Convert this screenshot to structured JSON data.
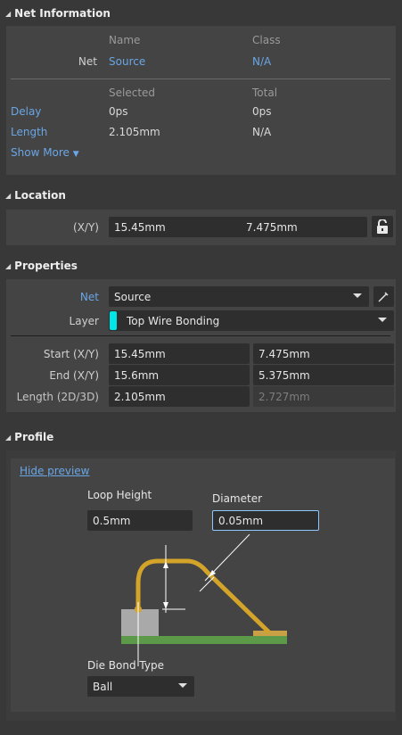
{
  "net_information": {
    "title": "Net Information",
    "col_name": "Name",
    "col_class": "Class",
    "net_label": "Net",
    "net_name": "Source",
    "net_class": "N/A",
    "col_selected": "Selected",
    "col_total": "Total",
    "delay_label": "Delay",
    "delay_selected": "0ps",
    "delay_total": "0ps",
    "length_label": "Length",
    "length_selected": "2.105mm",
    "length_total": "N/A",
    "show_more": "Show More"
  },
  "location": {
    "title": "Location",
    "xy_label": "(X/Y)",
    "x": "15.45mm",
    "y": "7.475mm"
  },
  "properties": {
    "title": "Properties",
    "net_label": "Net",
    "net_value": "Source",
    "layer_label": "Layer",
    "layer_value": "Top Wire Bonding",
    "layer_color": "#00e5e5",
    "start_label": "Start (X/Y)",
    "start_x": "15.45mm",
    "start_y": "7.475mm",
    "end_label": "End (X/Y)",
    "end_x": "15.6mm",
    "end_y": "5.375mm",
    "length_label": "Length (2D/3D)",
    "length_2d": "2.105mm",
    "length_3d": "2.727mm"
  },
  "profile": {
    "title": "Profile",
    "hide_preview": "Hide preview",
    "loop_height_label": "Loop Height",
    "loop_height_value": "0.5mm",
    "diameter_label": "Diameter",
    "diameter_value": "0.05mm",
    "die_bond_label": "Die Bond Type",
    "die_bond_value": "Ball"
  },
  "colors": {
    "background": "#383838",
    "panel": "#444444",
    "field": "#2e2e2e",
    "link": "#6aa6e6",
    "wire": "#d4a42a",
    "board": "#5c9a4a",
    "focus_border": "#8fc7ff"
  }
}
